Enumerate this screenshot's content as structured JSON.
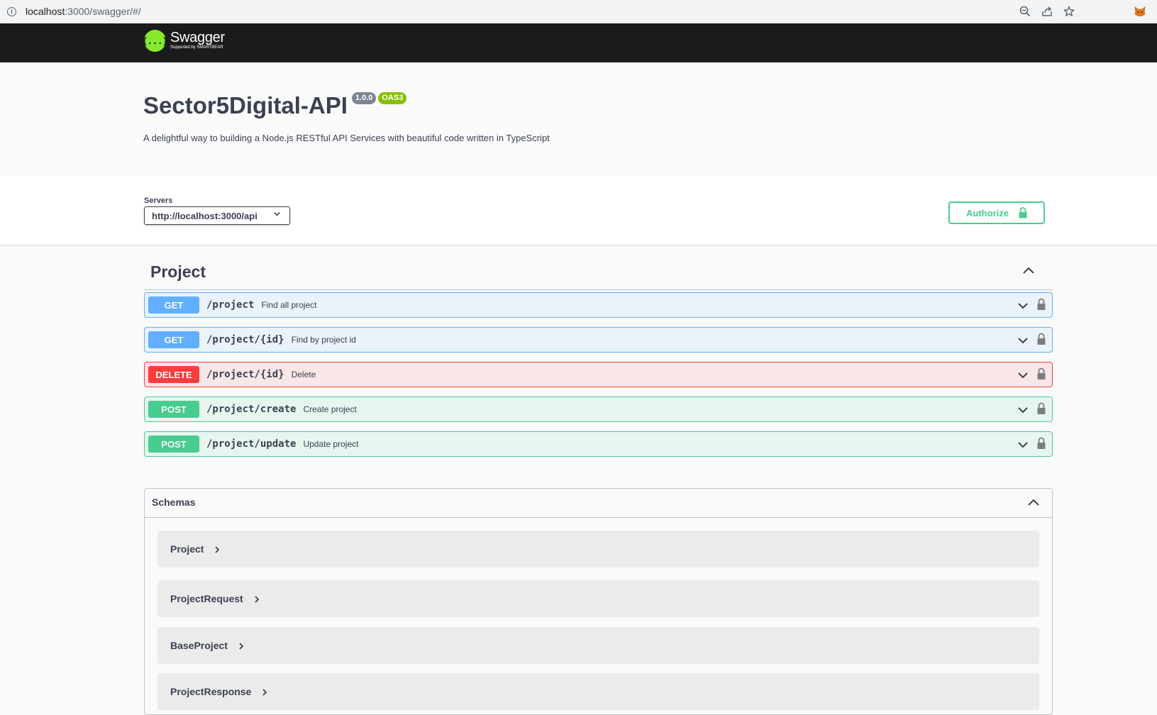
{
  "browser": {
    "url_host": "localhost",
    "url_rest": ":3000/swagger/#/"
  },
  "header": {
    "logo_word": "Swagger",
    "logo_sub": "Supported by SMARTBEAR",
    "logo_glyph": "{...}"
  },
  "info": {
    "title": "Sector5Digital-API",
    "version": "1.0.0",
    "oas": "OAS3",
    "description": "A delightful way to building a Node.js RESTful API Services with beautiful code written in TypeScript"
  },
  "servers": {
    "label": "Servers",
    "selected": "http://localhost:3000/api"
  },
  "authorize": {
    "label": "Authorize"
  },
  "tag": {
    "name": "Project"
  },
  "operations": [
    {
      "method": "GET",
      "path": "/project",
      "summary": "Find all project"
    },
    {
      "method": "GET",
      "path": "/project/{id}",
      "summary": "Find by project id"
    },
    {
      "method": "DELETE",
      "path": "/project/{id}",
      "summary": "Delete"
    },
    {
      "method": "POST",
      "path": "/project/create",
      "summary": "Create project"
    },
    {
      "method": "POST",
      "path": "/project/update",
      "summary": "Update project"
    }
  ],
  "schemas": {
    "title": "Schemas",
    "items": [
      "Project",
      "ProjectRequest",
      "BaseProject",
      "ProjectResponse"
    ]
  },
  "colors": {
    "get": "#61affe",
    "delete": "#f93e3e",
    "post": "#49cc90",
    "topbar": "#1b1b1b",
    "logo_green": "#85ea2d"
  }
}
